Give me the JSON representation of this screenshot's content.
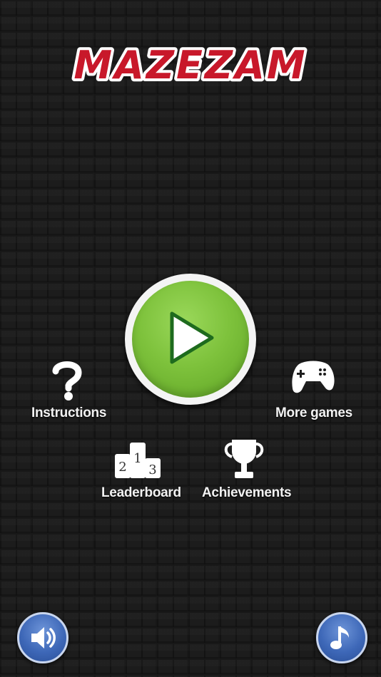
{
  "title": "MAZEZAM",
  "play_button": {
    "icon": "play-icon"
  },
  "menu": {
    "instructions": {
      "label": "Instructions",
      "icon": "question-mark-icon"
    },
    "more_games": {
      "label": "More games",
      "icon": "gamepad-icon"
    },
    "leaderboard": {
      "label": "Leaderboard",
      "icon": "podium-icon"
    },
    "achievements": {
      "label": "Achievements",
      "icon": "trophy-icon"
    }
  },
  "footer": {
    "sound_button": {
      "icon": "speaker-icon"
    },
    "music_button": {
      "icon": "music-note-icon"
    }
  },
  "colors": {
    "title_red": "#c8182a",
    "play_green": "#7ec23c",
    "round_button_blue": "#3e68b8",
    "background": "#1d1d1d"
  }
}
